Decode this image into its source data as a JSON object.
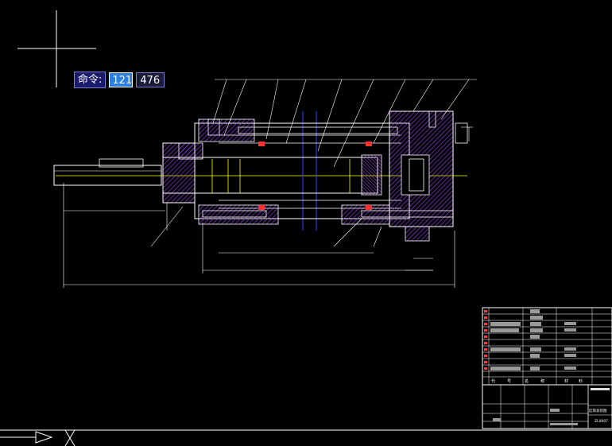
{
  "app": {
    "background": "#000000",
    "accent_purple": "#9b30ff",
    "axis_yellow": "#ffff00",
    "white": "#ffffff"
  },
  "command": {
    "label": "命令:",
    "x_value": "121",
    "y_value": "476"
  },
  "title_block": {
    "header_cells": [
      "代",
      "号",
      "名",
      "称",
      "材",
      "料"
    ],
    "part_code": "ZL0007",
    "drawing_name": "缸筒总装图"
  },
  "icons": {
    "crosshair": "crosshair-cursor-icon",
    "ucs": "ucs-arrow-icon",
    "cross": "x-mark-icon"
  }
}
